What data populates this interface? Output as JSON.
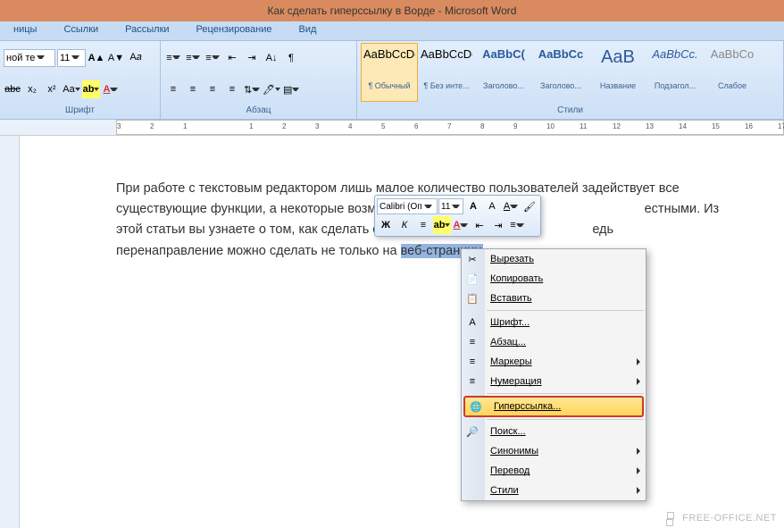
{
  "title": "Как сделать гиперссылку в Ворде - Microsoft Word",
  "tabs": {
    "t1": "ницы",
    "t2": "Ссылки",
    "t3": "Рассылки",
    "t4": "Рецензирование",
    "t5": "Вид"
  },
  "font": {
    "name_fragment": "ной те",
    "size": "11",
    "group_label": "Шрифт"
  },
  "para": {
    "group_label": "Абзац"
  },
  "styles": {
    "group_label": "Стили",
    "items": [
      {
        "preview": "AaBbCcDc",
        "name": "¶ Обычный"
      },
      {
        "preview": "AaBbCcDc",
        "name": "¶ Без инте..."
      },
      {
        "preview": "AaBbC(",
        "name": "Заголово..."
      },
      {
        "preview": "AaBbCc",
        "name": "Заголово..."
      },
      {
        "preview": "AaB",
        "name": "Название"
      },
      {
        "preview": "AaBbCc.",
        "name": "Подзагол..."
      },
      {
        "preview": "AaBbCo",
        "name": "Слабое"
      }
    ]
  },
  "ruler_nums": [
    "3",
    "2",
    "1",
    "",
    "1",
    "2",
    "3",
    "4",
    "5",
    "6",
    "7",
    "8",
    "9",
    "10",
    "11",
    "12",
    "13",
    "14",
    "15",
    "16",
    "17"
  ],
  "doc": {
    "p1a": "При работе с текстовым редактором лишь малое количество пользователей задействует все существующие функции, а некоторые возможности пр",
    "p1b": "естными.",
    "p2a": "Из этой статьи вы узнаете о том, как сделать ссылку в В",
    "p2b": "едь перенаправление можно сделать не только на ",
    "selected": "веб-страницу."
  },
  "mini": {
    "font": "Calibri (Оп",
    "size": "11"
  },
  "ctx": {
    "cut": "Вырезать",
    "copy": "Копировать",
    "paste": "Вставить",
    "font": "Шрифт...",
    "para": "Абзац...",
    "bullets": "Маркеры",
    "numbering": "Нумерация",
    "hyperlink": "Гиперссылка...",
    "lookup": "Поиск...",
    "synonyms": "Синонимы",
    "translate": "Перевод",
    "styles": "Стили"
  },
  "watermark": "FREE-OFFICE.NET"
}
